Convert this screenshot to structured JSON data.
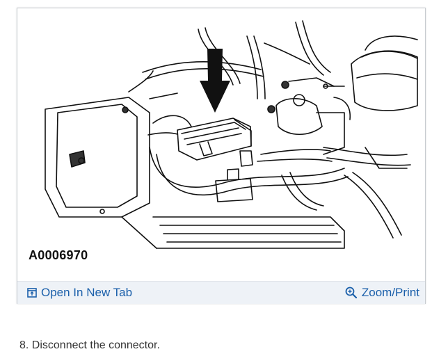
{
  "figure": {
    "image_label": "A0006970",
    "illustration": "engine-connector-diagram"
  },
  "toolbar": {
    "open_new_tab_label": "Open In New Tab",
    "open_new_tab_icon": "open-new-tab-icon",
    "zoom_print_label": "Zoom/Print",
    "zoom_print_icon": "zoom-in-icon",
    "link_color": "#1a5faa",
    "bar_color": "#eef2f7"
  },
  "step": {
    "text": "8. Disconnect the connector."
  }
}
